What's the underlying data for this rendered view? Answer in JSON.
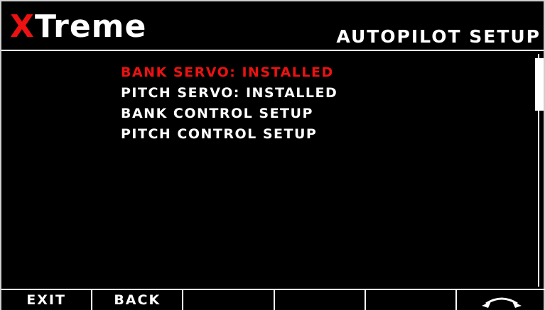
{
  "header": {
    "logo_x": "X",
    "logo_rest": "Treme",
    "title": "AUTOPILOT SETUP"
  },
  "menu": {
    "items": [
      {
        "label": "BANK SERVO: INSTALLED",
        "selected": true
      },
      {
        "label": "PITCH SERVO: INSTALLED",
        "selected": false
      },
      {
        "label": "BANK CONTROL SETUP",
        "selected": false
      },
      {
        "label": "PITCH CONTROL SETUP",
        "selected": false
      }
    ]
  },
  "softkeys": {
    "key1": "EXIT",
    "key2": "BACK",
    "key3": "",
    "key4": "",
    "key5": "",
    "key6_icon": "rotary-knob-icon"
  },
  "colors": {
    "accent": "#ee1111",
    "background": "#000000",
    "text": "#ffffff"
  }
}
